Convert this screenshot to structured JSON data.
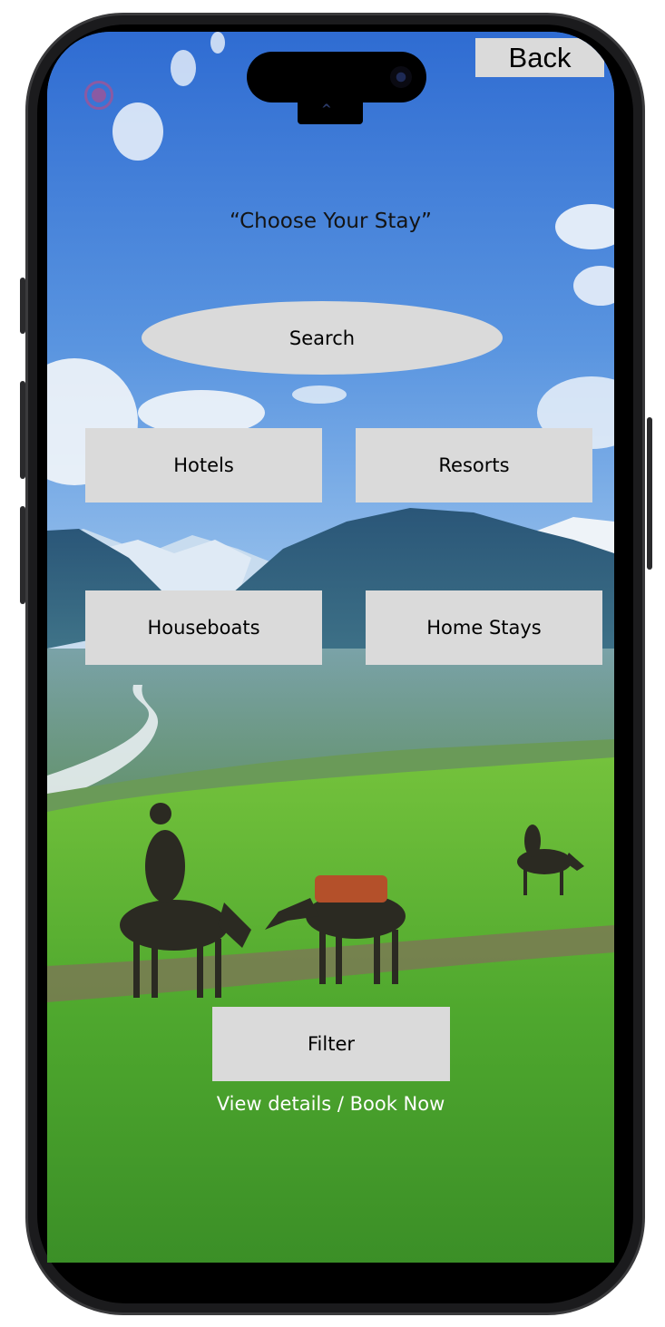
{
  "header": {
    "back_label": "Back",
    "record_icon": "record-icon"
  },
  "main": {
    "title": "“Choose Your Stay”",
    "search_label": "Search",
    "categories": [
      {
        "label": "Hotels"
      },
      {
        "label": "Resorts"
      },
      {
        "label": "Houseboats"
      },
      {
        "label": "Home Stays"
      }
    ],
    "filter_label": "Filter",
    "details_link": "View details / Book Now"
  },
  "colors": {
    "button_bg": "#dadada",
    "sky": "#4a83d6",
    "meadow": "#5fb83a"
  }
}
